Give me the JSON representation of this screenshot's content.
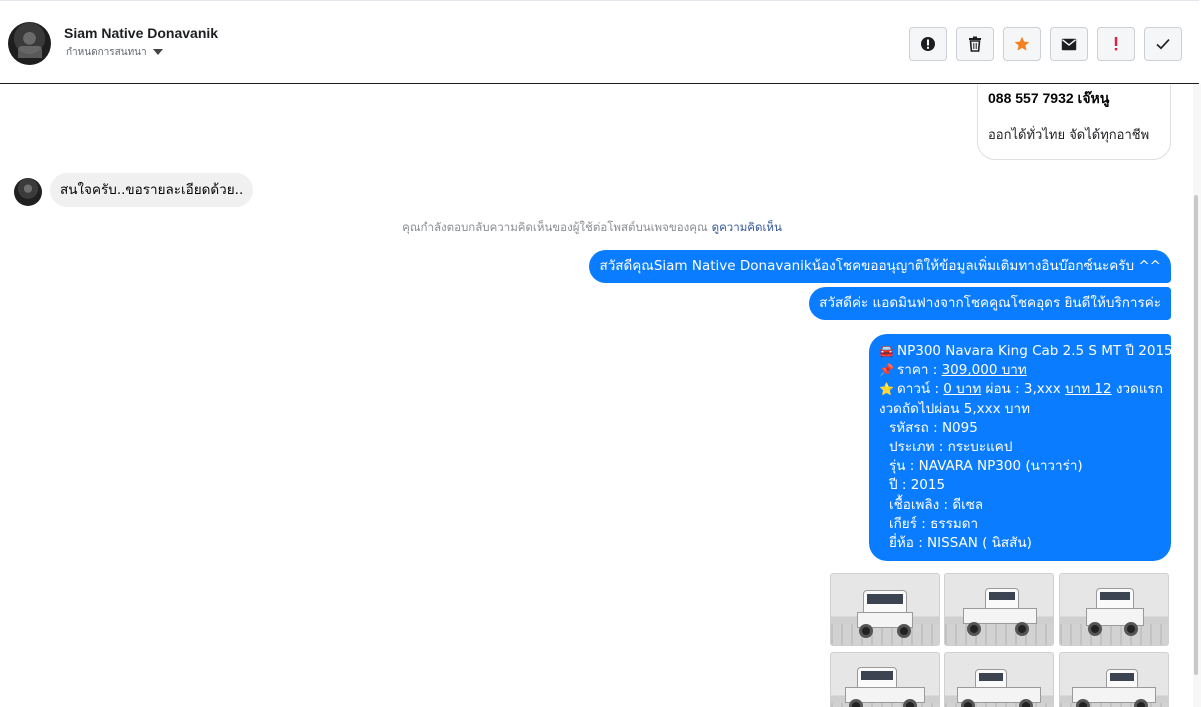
{
  "header": {
    "name": "Siam Native Donavanik",
    "subtitle": "กำหนดการสนทนา",
    "actions": [
      {
        "icon": "alert-circle-icon"
      },
      {
        "icon": "trash-icon"
      },
      {
        "icon": "star-icon",
        "color": "#f5821f"
      },
      {
        "icon": "envelope-icon"
      },
      {
        "icon": "exclamation-icon",
        "color": "#e41e3f"
      },
      {
        "icon": "check-icon"
      }
    ]
  },
  "prev_card": {
    "phone": "088 557 7932 เจ๊หนู",
    "note": "ออกได้ทั่วไทย จัดได้ทุกอาชีพ"
  },
  "incoming": {
    "text": "สนใจครับ..ขอรายละเอียดด้วย.."
  },
  "notice": {
    "text": "คุณกำลังตอบกลับความคิดเห็นของผู้ใช้ต่อโพสต์บนเพจของคุณ",
    "link": "ดูความคิดเห็น"
  },
  "outgoing": [
    "สวัสดีคุณSiam Native Donavanikน้องโชคขออนุญาติให้ข้อมูลเพิ่มเติมทางอินบ๊อกซ์นะครับ ^^",
    "สวัสดีค่ะ แอดมินฟางจากโชคคูณโชคอุดร ยินดีให้บริการค่ะ"
  ],
  "listing": {
    "title_icon": "🚘",
    "title": "NP300 Navara King Cab 2.5 S MT ปี 2015",
    "price_icon": "📌",
    "price_label": "ราคา :",
    "price": "309,000 บาท",
    "down_icon": "⭐",
    "down_label": "ดาวน์ :",
    "down": "0 บาท",
    "installment_label": "ผ่อน : 3,xxx",
    "installment_first": "บาท 12",
    "installment_suffix": "งวดแรก",
    "next_installment": "งวดถัดไปผ่อน  5,xxx บาท",
    "code": "รหัสรถ : N095",
    "type": "ประเภท : กระบะแคป",
    "model": "รุ่น : NAVARA NP300 (นาวาร่า)",
    "year": "ปี : 2015",
    "fuel": "เชื้อเพลิง : ดีเซล",
    "gear": "เกียร์ : ธรรมดา",
    "brand": "ยี่ห้อ : NISSAN ( นิสสัน)"
  },
  "colors": {
    "bubble_out": "#0a7cff",
    "bubble_in": "#f0f0f0",
    "link": "#365899"
  }
}
